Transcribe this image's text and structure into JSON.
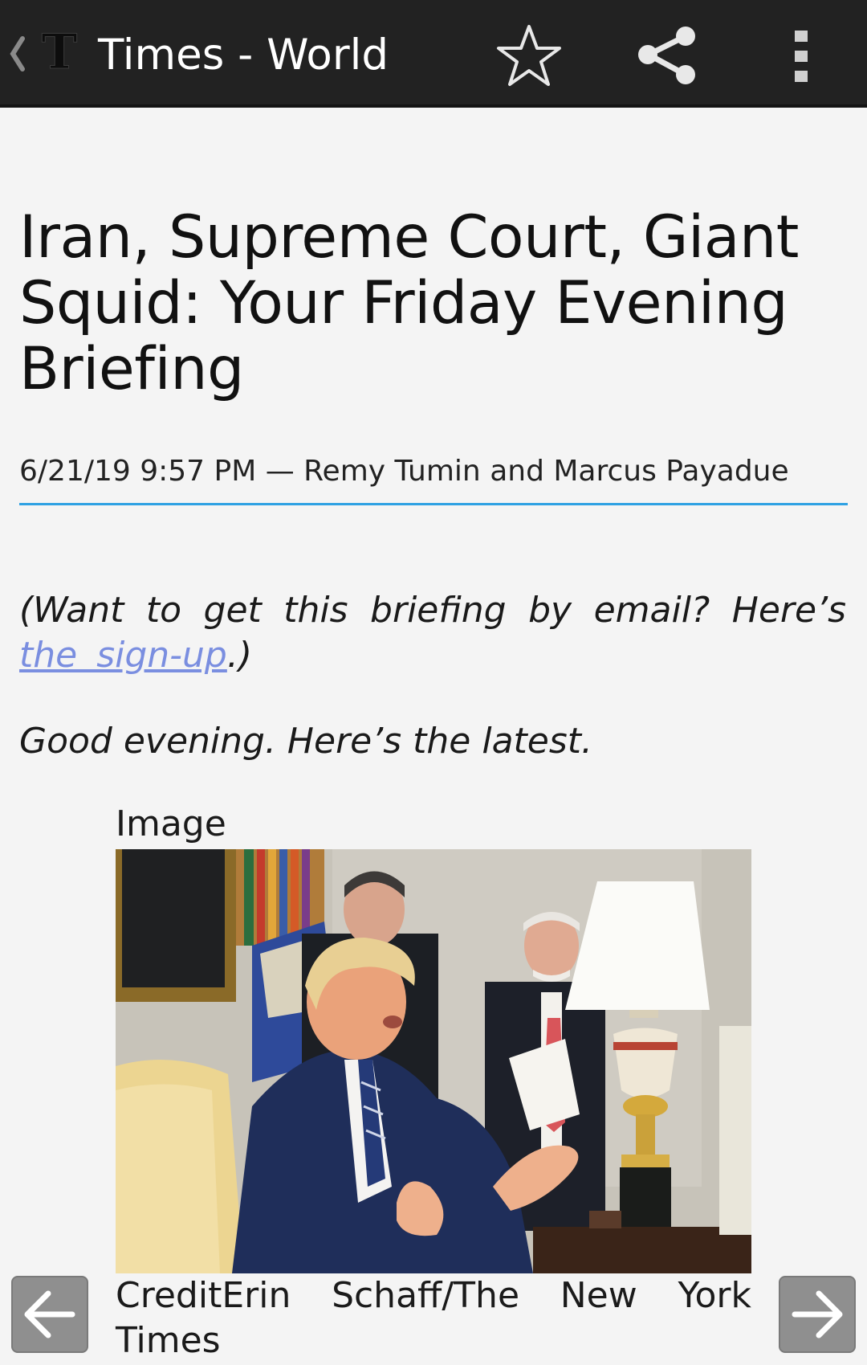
{
  "toolbar": {
    "title": "Times - World",
    "icons": [
      "back-chevron-icon",
      "nyt-logo-icon",
      "star-icon",
      "share-icon",
      "more-vert-icon"
    ],
    "logo_letter": "T"
  },
  "article": {
    "headline": "Iran, Supreme Court, Giant Squid: Your Friday Evening Briefing",
    "byline": "6/21/19 9:57 PM — Remy Tumin and Marcus Payadue",
    "intro_prefix": "(Want to get this briefing by email? Here’s ",
    "intro_link": "the sign-up",
    "intro_suffix": ".)",
    "greeting": "Good evening. Here’s the latest.",
    "image_label": "Image",
    "image_caption": "CreditErin Schaff/The New York Times"
  },
  "navigation": {
    "prev_icon": "arrow-left-icon",
    "next_icon": "arrow-right-icon"
  },
  "colors": {
    "toolbar_bg": "#222222",
    "accent_rule": "#2ea1e3",
    "link": "#7a8ee0",
    "nav_button": "#8f8f8f"
  }
}
